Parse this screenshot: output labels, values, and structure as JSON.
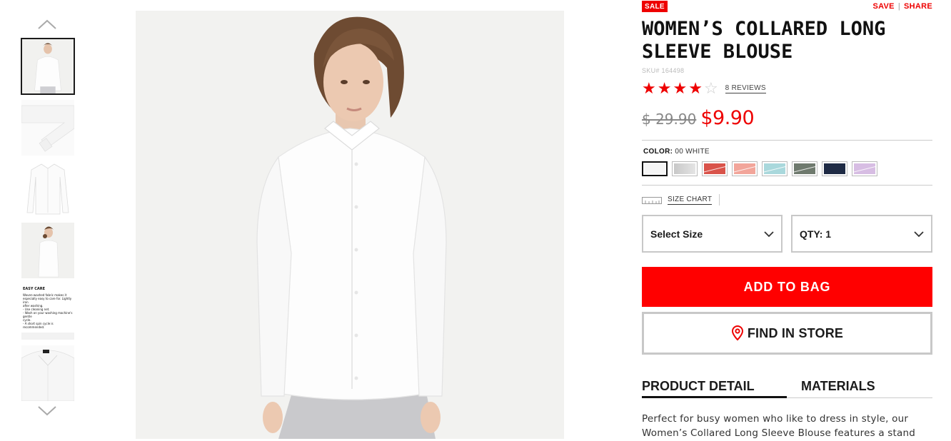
{
  "product": {
    "badge": "SALE",
    "actions": {
      "save": "SAVE",
      "share": "SHARE",
      "separator": "|"
    },
    "title_line1": "WOMEN’S COLLARED LONG",
    "title_line2": "SLEEVE BLOUSE",
    "sku": "SKU# 164498",
    "rating": {
      "value": 4,
      "max": 5,
      "reviews_label": "8 REVIEWS"
    },
    "price": {
      "original": "$ 29.90",
      "sale": "$9.90"
    },
    "color": {
      "label": "COLOR:",
      "selected_name": "00 WHITE",
      "swatches": [
        {
          "name": "white",
          "hex": "#f5f5f5",
          "selected": true
        },
        {
          "name": "light-gray",
          "hex": "#d2d2d2",
          "selected": false
        },
        {
          "name": "red",
          "hex": "#d9534a",
          "selected": false
        },
        {
          "name": "pink",
          "hex": "#f2a59a",
          "selected": false
        },
        {
          "name": "light-blue",
          "hex": "#a9d8dc",
          "selected": false
        },
        {
          "name": "olive",
          "hex": "#6f7a6e",
          "selected": false
        },
        {
          "name": "navy",
          "hex": "#1f2b45",
          "selected": false
        },
        {
          "name": "lavender",
          "hex": "#d7bde3",
          "selected": false
        }
      ]
    },
    "size_chart_label": "SIZE CHART",
    "size_select": {
      "value": "Select Size"
    },
    "qty_select": {
      "value": "QTY: 1"
    },
    "add_to_bag": "ADD TO BAG",
    "find_in_store": "FIND IN STORE",
    "tabs": {
      "detail": "PRODUCT DETAIL",
      "materials": "MATERIALS"
    },
    "description": "Perfect for busy women who like to dress in style, our Women’s Collared Long Sleeve Blouse features a stand"
  },
  "thumbnails": {
    "count": 6,
    "active_index": 0,
    "care_card": {
      "heading": "EASY CARE",
      "lines": [
        "Woven-washed fabric makes it",
        "especially easy to care for. Lightly iron",
        "after washing.",
        "- Use cleaning net.",
        "- Wash on your washing machine's gentle",
        "cycle.",
        "- A short spin cycle is recommended."
      ]
    }
  },
  "colors": {
    "accent": "#ff0000",
    "sale_red": "#e00000",
    "border": "#c8c8c8"
  }
}
